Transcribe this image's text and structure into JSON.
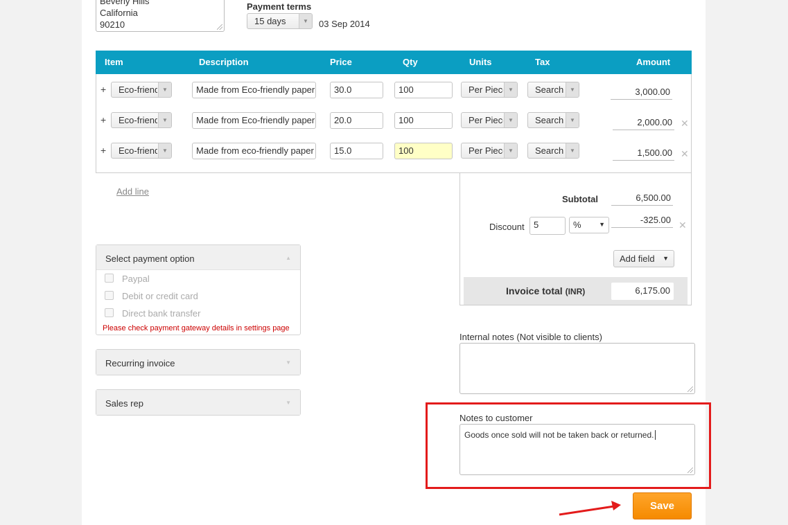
{
  "address": {
    "lines": [
      "Beverly Hills",
      "California",
      "90210"
    ]
  },
  "payment_terms": {
    "label": "Payment terms",
    "value": "15 days",
    "date": "03 Sep 2014"
  },
  "table": {
    "headers": {
      "item": "Item",
      "description": "Description",
      "price": "Price",
      "qty": "Qty",
      "units": "Units",
      "tax": "Tax",
      "amount": "Amount"
    },
    "rows": [
      {
        "item": "Eco-friendly",
        "description": "Made from Eco-friendly paper",
        "price": "30.0",
        "qty": "100",
        "units": "Per Piece",
        "tax": "Search",
        "amount": "3,000.00"
      },
      {
        "item": "Eco-friendly",
        "description": "Made from Eco-friendly paper",
        "price": "20.0",
        "qty": "100",
        "units": "Per Piece",
        "tax": "Search",
        "amount": "2,000.00"
      },
      {
        "item": "Eco-friendly",
        "description": "Made from eco-friendly paper",
        "price": "15.0",
        "qty": "100",
        "units": "Per Piece",
        "tax": "Search",
        "amount": "1,500.00"
      }
    ],
    "add_line": "Add line"
  },
  "totals": {
    "subtotal_label": "Subtotal",
    "subtotal": "6,500.00",
    "discount_label": "Discount",
    "discount_value": "5",
    "discount_type": "%",
    "discount_amount": "-325.00",
    "add_field": "Add field",
    "invoice_total_label": "Invoice total",
    "currency": "(INR)",
    "invoice_total": "6,175.00"
  },
  "payment_panel": {
    "title": "Select payment option",
    "options": [
      "Paypal",
      "Debit or credit card",
      "Direct bank transfer"
    ],
    "warning": "Please check payment gateway details in settings page"
  },
  "recurring_panel": {
    "title": "Recurring invoice"
  },
  "sales_rep_panel": {
    "title": "Sales rep"
  },
  "internal_notes": {
    "label": "Internal notes (Not visible to clients)",
    "value": ""
  },
  "customer_notes": {
    "label": "Notes to customer",
    "value": "Goods once sold will not be taken back or returned."
  },
  "save_label": "Save",
  "colors": {
    "header": "#0b9ec2",
    "save": "#f7941d",
    "highlight": "#e31b1b",
    "warning": "#cc0000"
  }
}
